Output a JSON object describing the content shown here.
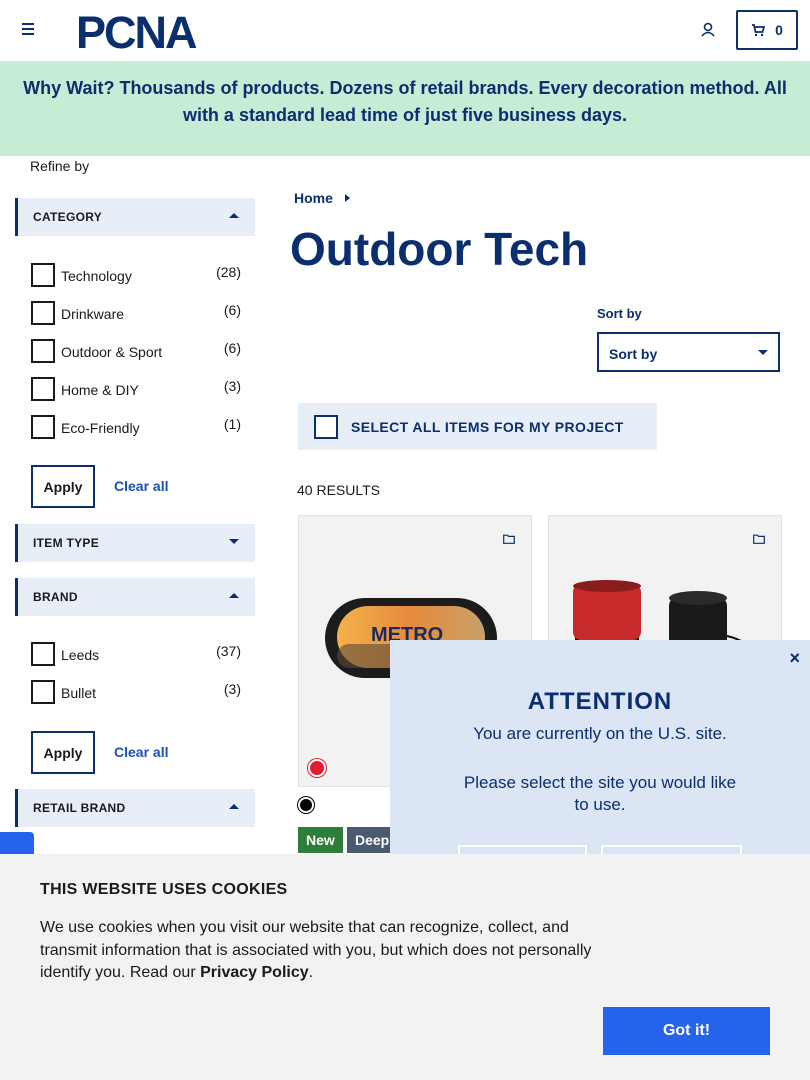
{
  "header": {
    "logo_text": "PCNA",
    "cart_count": "0"
  },
  "banner": {
    "text": "Why Wait? Thousands of products. Dozens of retail brands. Every decoration method. All with a standard lead time of just five business days."
  },
  "sidebar": {
    "refine_label": "Refine by",
    "category": {
      "title": "CATEGORY",
      "options": [
        {
          "label": "Technology",
          "count": "(28)"
        },
        {
          "label": "Drinkware",
          "count": "(6)"
        },
        {
          "label": "Outdoor & Sport",
          "count": "(6)"
        },
        {
          "label": "Home & DIY",
          "count": "(3)"
        },
        {
          "label": "Eco-Friendly",
          "count": "(1)"
        }
      ],
      "apply": "Apply",
      "clear": "Clear all"
    },
    "item_type": {
      "title": "ITEM TYPE"
    },
    "brand": {
      "title": "BRAND",
      "options": [
        {
          "label": "Leeds",
          "count": "(37)"
        },
        {
          "label": "Bullet",
          "count": "(3)"
        }
      ],
      "apply": "Apply",
      "clear": "Clear all"
    },
    "retail_brand": {
      "title": "RETAIL BRAND"
    }
  },
  "main": {
    "breadcrumb_home": "Home",
    "title": "Outdoor Tech",
    "sort_label": "Sort by",
    "sort_value": "Sort by",
    "select_all": "SELECT ALL ITEMS FOR MY PROJECT",
    "results": "40 RESULTS",
    "card1_print": "METRO",
    "badges": {
      "new": "New",
      "deep": "Deep"
    }
  },
  "attention": {
    "close": "×",
    "title": "ATTENTION",
    "line1": "You are currently on the U.S. site.",
    "line2": "Please select the site you would like to use."
  },
  "cookie": {
    "title": "THIS WEBSITE USES COOKIES",
    "text": "We use cookies when you visit our website that can recognize, collect, and transmit information that is associated with you, but which does not personally identify you. Read our",
    "policy_link": "Privacy Policy",
    "period": ".",
    "button": "Got it!"
  },
  "colors": {
    "navy": "#0b2e6e",
    "banner_bg": "#c6ecd6",
    "button_blue": "#2563eb",
    "swatch_red": "#e21b2f",
    "badge_new": "#2f7d3b"
  }
}
